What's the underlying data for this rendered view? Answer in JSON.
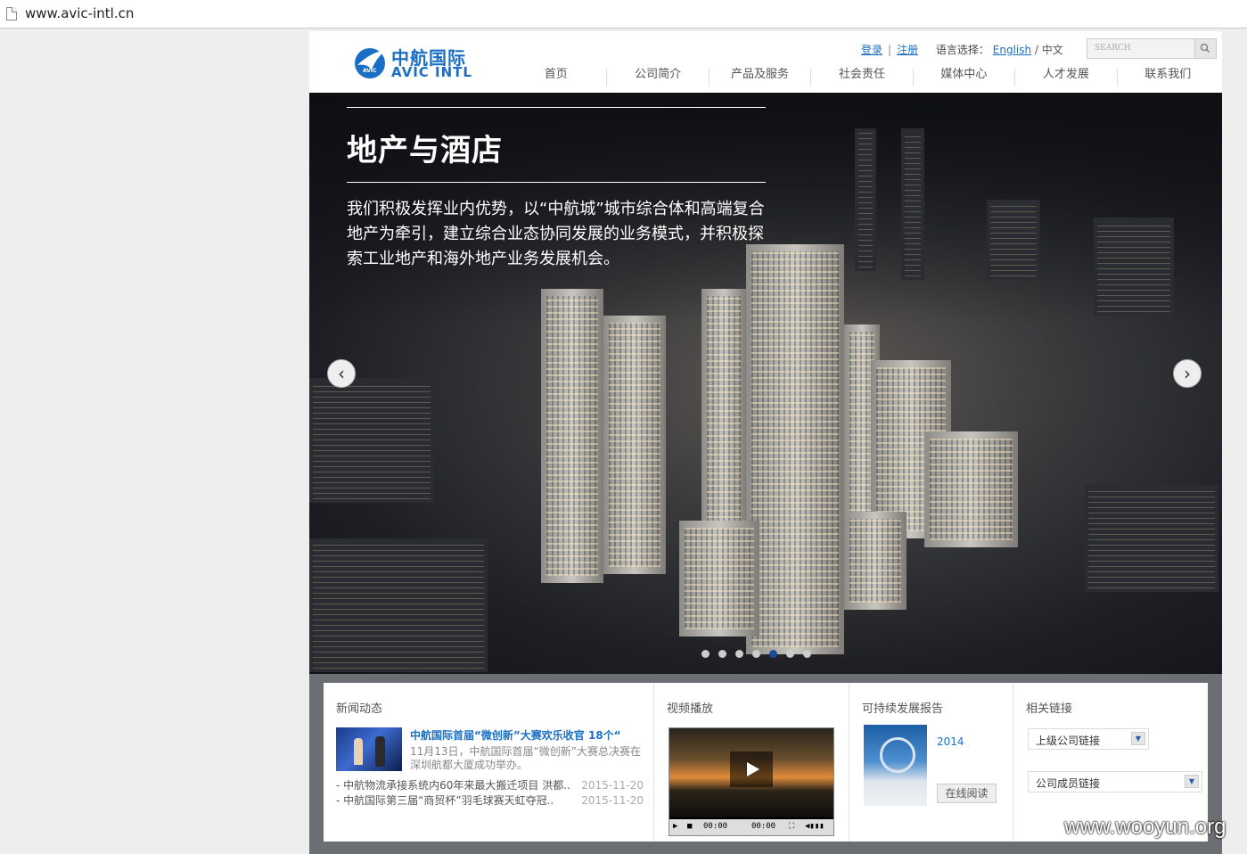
{
  "browser": {
    "url": "www.avic-intl.cn"
  },
  "logo": {
    "cn": "中航国际",
    "en": "AVIC INTL",
    "badge": "AVIC"
  },
  "toplinks": {
    "login": "登录",
    "register": "注册",
    "separator": "|",
    "lang_label": "语言选择：",
    "english": "English",
    "slash": "/",
    "chinese": "中文"
  },
  "search": {
    "placeholder": "SEARCH",
    "icon": "magnifier-icon"
  },
  "nav": {
    "items": [
      "首页",
      "公司简介",
      "产品及服务",
      "社会责任",
      "媒体中心",
      "人才发展",
      "联系我们"
    ]
  },
  "hero": {
    "title": "地产与酒店",
    "text": "我们积极发挥业内优势，以“中航城”城市综合体和高端复合地产为牵引，建立综合业态协同发展的业务模式，并积极探索工业地产和海外地产业务发展机会。",
    "prev_glyph": "‹",
    "next_glyph": "›",
    "slide_count": 7,
    "active_slide": 5
  },
  "news": {
    "heading": "新闻动态",
    "featured_title": "中航国际首届“微创新”大赛欢乐收官 18个“",
    "featured_summary": "11月13日，中航国际首届“微创新”大赛总决赛在深圳航都大厦成功举办。",
    "items": [
      {
        "title": "- 中航物流承接系统内60年来最大搬迁项目 洪都..",
        "date": "2015-11-20"
      },
      {
        "title": "- 中航国际第三届“商贸杯”羽毛球赛天虹夺冠..",
        "date": "2015-11-20"
      }
    ]
  },
  "video": {
    "heading": "视频播放",
    "time_current": "00:00",
    "time_total": "00:00"
  },
  "report": {
    "heading": "可持续发展报告",
    "year": "2014",
    "read_button": "在线阅读"
  },
  "links": {
    "heading": "相关链接",
    "select1": "上级公司链接",
    "select2": "公司成员链接"
  },
  "watermark": "www.wooyun.org",
  "colors": {
    "brand_blue": "#1a6fc4",
    "active_dot": "#1a4e9a",
    "bottom_band": "#6b6e73"
  }
}
